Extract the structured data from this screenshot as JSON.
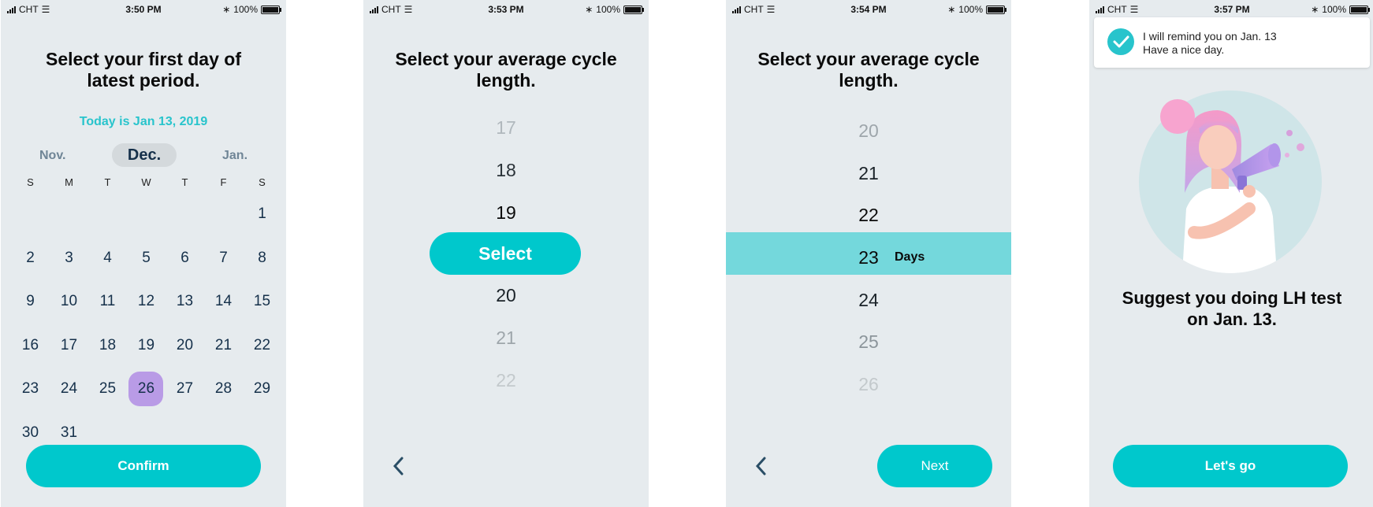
{
  "colors": {
    "accent": "#00c8cc",
    "selected_day": "#b99be6",
    "background": "#e6ebee"
  },
  "screens": [
    {
      "status": {
        "carrier": "CHT",
        "time": "3:50 PM",
        "battery": "100%"
      },
      "title_line1": "Select your first day of",
      "title_line2": "latest period.",
      "today": "Today is Jan 13, 2019",
      "months": {
        "prev": "Nov.",
        "current": "Dec.",
        "next": "Jan."
      },
      "weekdays": [
        "S",
        "M",
        "T",
        "W",
        "T",
        "F",
        "S"
      ],
      "weeks": [
        [
          "",
          "",
          "",
          "",
          "",
          "",
          "1"
        ],
        [
          "2",
          "3",
          "4",
          "5",
          "6",
          "7",
          "8"
        ],
        [
          "9",
          "10",
          "11",
          "12",
          "13",
          "14",
          "15"
        ],
        [
          "16",
          "17",
          "18",
          "19",
          "20",
          "21",
          "22"
        ],
        [
          "23",
          "24",
          "25",
          "26",
          "27",
          "28",
          "29"
        ],
        [
          "30",
          "31",
          "",
          "",
          "",
          "",
          ""
        ]
      ],
      "selected_day": "26",
      "confirm_label": "Confirm"
    },
    {
      "status": {
        "carrier": "CHT",
        "time": "3:53 PM",
        "battery": "100%"
      },
      "title_line1": "Select your average cycle",
      "title_line2": "length.",
      "above": [
        "17",
        "18",
        "19"
      ],
      "select_label": "Select",
      "below": [
        "20",
        "21",
        "22"
      ],
      "back_icon": "chevron-left-icon"
    },
    {
      "status": {
        "carrier": "CHT",
        "time": "3:54 PM",
        "battery": "100%"
      },
      "title_line1": "Select your average cycle",
      "title_line2": "length.",
      "above": [
        "20",
        "21",
        "22"
      ],
      "selected": "23",
      "unit": "Days",
      "below": [
        "24",
        "25",
        "26"
      ],
      "next_label": "Next",
      "back_icon": "chevron-left-icon"
    },
    {
      "status": {
        "carrier": "CHT",
        "time": "3:57 PM",
        "battery": "100%"
      },
      "toast_line1": "I will remind you on Jan. 13",
      "toast_line2": "Have a nice day.",
      "suggest_line1": "Suggest you doing LH test",
      "suggest_line2": "on  Jan. 13.",
      "cta_label": "Let's go"
    }
  ]
}
